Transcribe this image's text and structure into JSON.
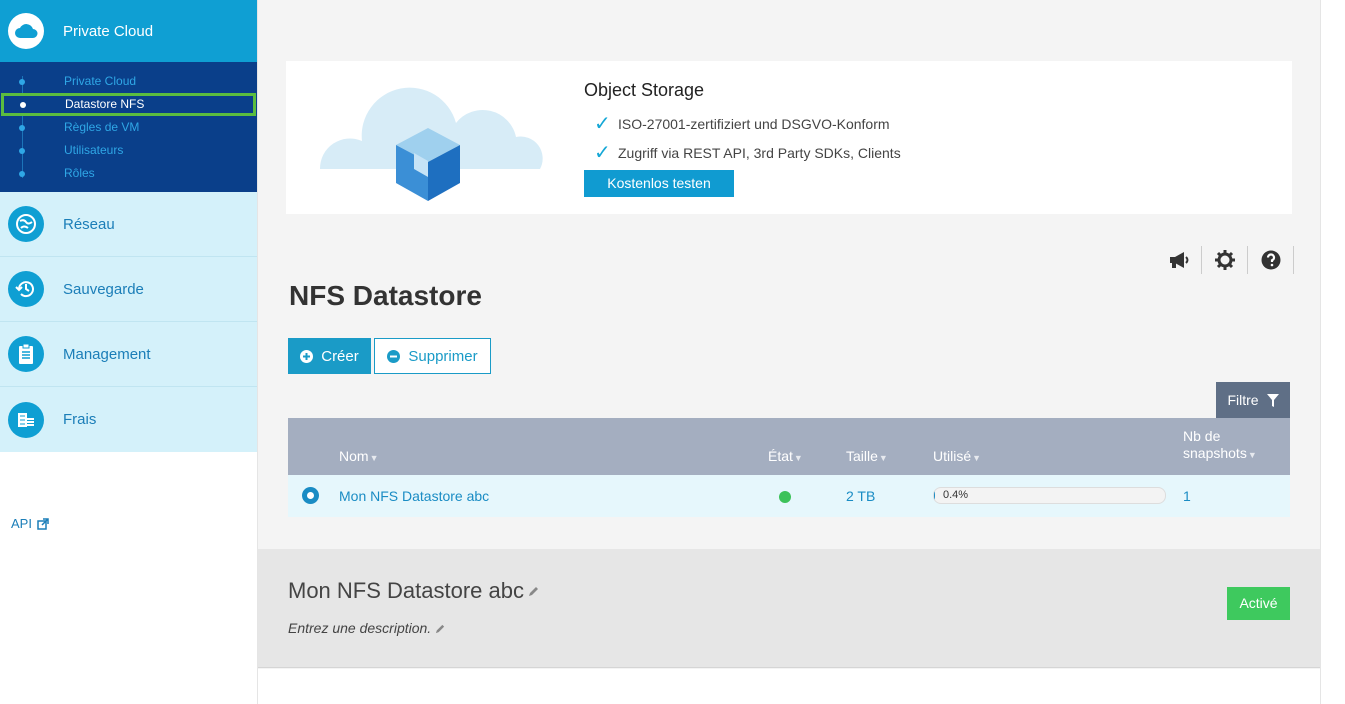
{
  "sidebar": {
    "active_section": "Private Cloud",
    "subitems": [
      {
        "label": "Private Cloud",
        "active": false
      },
      {
        "label": "Datastore NFS",
        "active": true
      },
      {
        "label": "Règles de VM",
        "active": false
      },
      {
        "label": "Utilisateurs",
        "active": false
      },
      {
        "label": "Rôles",
        "active": false
      }
    ],
    "sections": [
      {
        "label": "Réseau",
        "icon": "globe-icon"
      },
      {
        "label": "Sauvegarde",
        "icon": "history-icon"
      },
      {
        "label": "Management",
        "icon": "clipboard-icon"
      },
      {
        "label": "Frais",
        "icon": "coins-icon"
      }
    ],
    "api_label": "API"
  },
  "banner": {
    "title": "Object Storage",
    "features": [
      "ISO-27001-zertifiziert und DSGVO-Konform",
      "Zugriff via REST API, 3rd Party SDKs, Clients"
    ],
    "check_glyph": "✓",
    "cta_label": "Kostenlos testen"
  },
  "page": {
    "title": "NFS Datastore",
    "create_label": "Créer",
    "delete_label": "Supprimer",
    "filter_label": "Filtre"
  },
  "table": {
    "columns": {
      "name": "Nom",
      "state": "État",
      "size": "Taille",
      "used": "Utilisé",
      "snapshots_line1": "Nb de",
      "snapshots_line2": "snapshots"
    },
    "rows": [
      {
        "name": "Mon NFS Datastore abc",
        "state": "active",
        "size": "2 TB",
        "used_label": "0.4%",
        "used_fraction": 0.004,
        "snapshots": "1"
      }
    ]
  },
  "detail": {
    "title": "Mon NFS Datastore abc",
    "description": "Entrez une description.",
    "status": "Activé"
  },
  "colors": {
    "accent": "#1a9bc7",
    "status_active": "#3dc25a",
    "sidebar_dark": "#0a3f8a",
    "selection_outline": "#5bbd3f"
  }
}
